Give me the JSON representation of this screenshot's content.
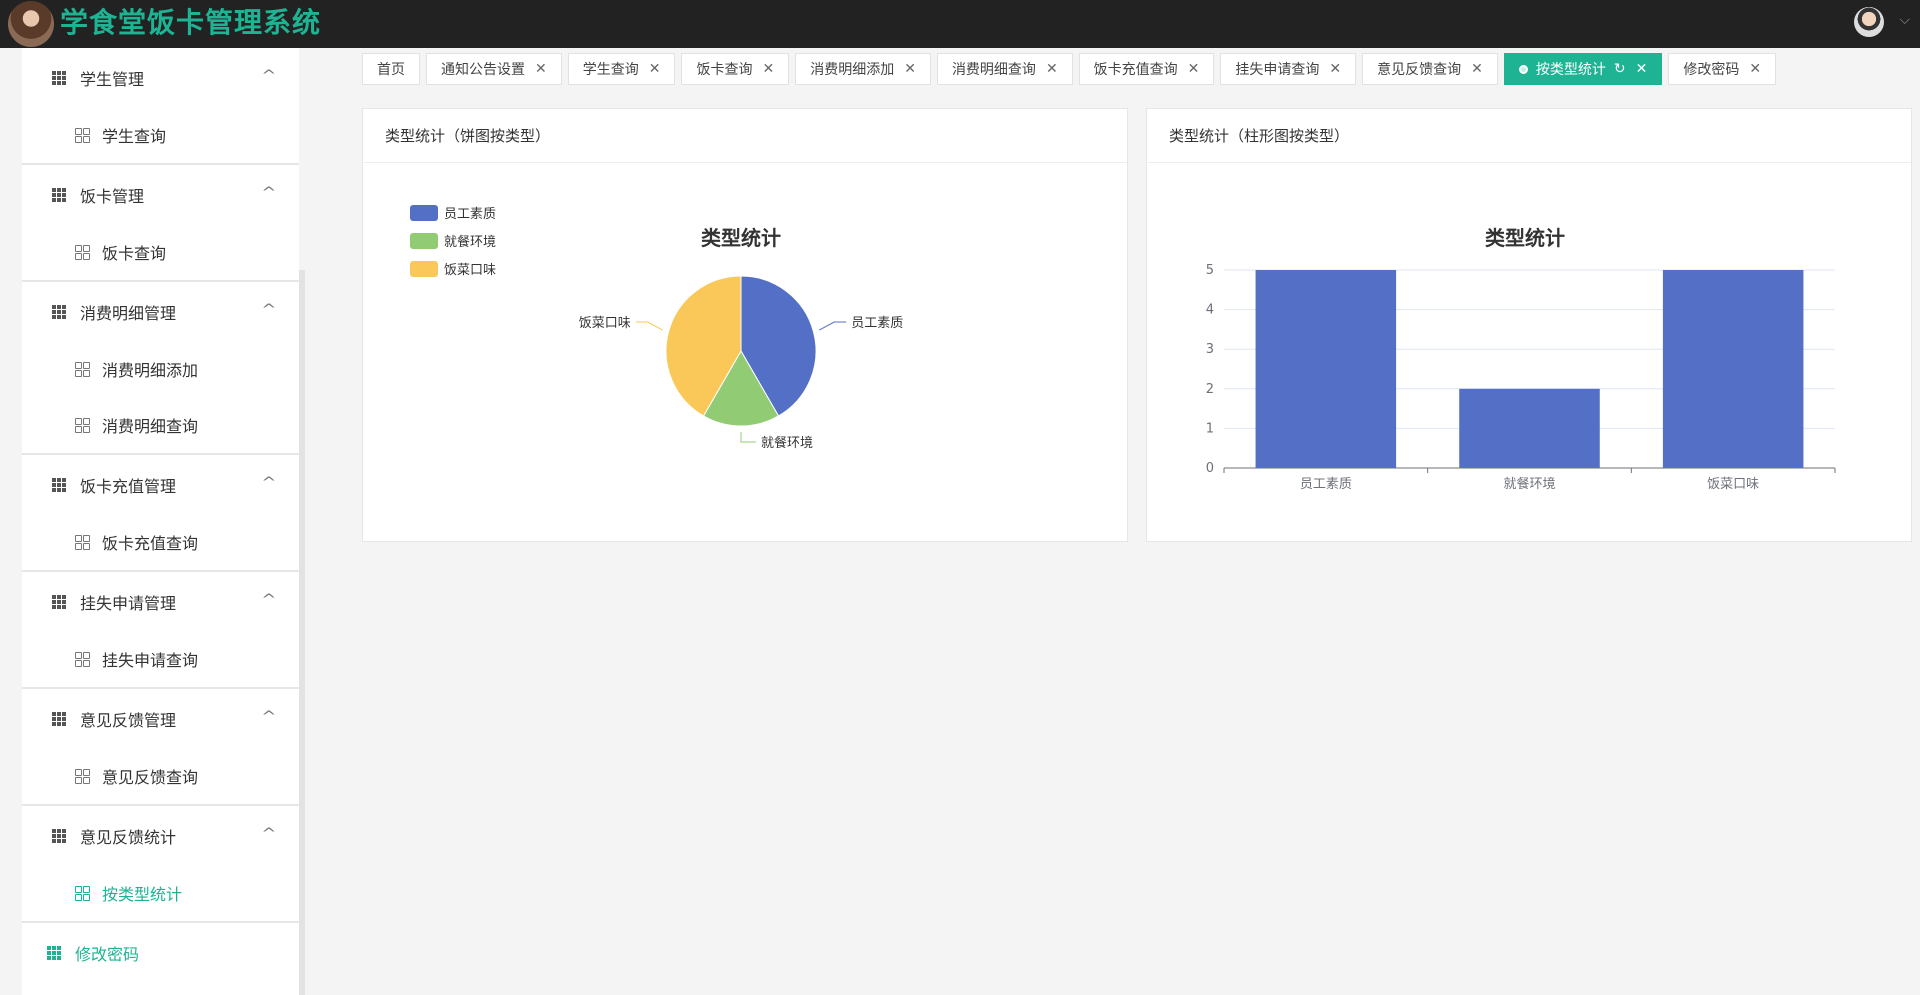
{
  "header": {
    "title": "学食堂饭卡管理系统"
  },
  "sidebar": {
    "groups": [
      {
        "label": "学生管理",
        "items": [
          "学生查询"
        ]
      },
      {
        "label": "饭卡管理",
        "items": [
          "饭卡查询"
        ]
      },
      {
        "label": "消费明细管理",
        "items": [
          "消费明细添加",
          "消费明细查询"
        ]
      },
      {
        "label": "饭卡充值管理",
        "items": [
          "饭卡充值查询"
        ]
      },
      {
        "label": "挂失申请管理",
        "items": [
          "挂失申请查询"
        ]
      },
      {
        "label": "意见反馈管理",
        "items": [
          "意见反馈查询"
        ]
      },
      {
        "label": "意见反馈统计",
        "items": [
          "按类型统计"
        ]
      }
    ],
    "bottom_item": "修改密码",
    "active_item": "按类型统计"
  },
  "tabs": [
    {
      "label": "首页",
      "closable": false
    },
    {
      "label": "通知公告设置",
      "closable": true
    },
    {
      "label": "学生查询",
      "closable": true
    },
    {
      "label": "饭卡查询",
      "closable": true
    },
    {
      "label": "消费明细添加",
      "closable": true
    },
    {
      "label": "消费明细查询",
      "closable": true
    },
    {
      "label": "饭卡充值查询",
      "closable": true
    },
    {
      "label": "挂失申请查询",
      "closable": true
    },
    {
      "label": "意见反馈查询",
      "closable": true
    },
    {
      "label": "按类型统计",
      "closable": true,
      "active": true
    },
    {
      "label": "修改密码",
      "closable": true
    }
  ],
  "cards": {
    "pie_title": "类型统计（饼图按类型）",
    "bar_title": "类型统计（柱形图按类型）"
  },
  "colors": {
    "accent": "#1eb393",
    "blue": "#5470c6",
    "green": "#91cc75",
    "yellow": "#fac858"
  },
  "chart_data": [
    {
      "type": "pie",
      "title": "类型统计",
      "categories": [
        "员工素质",
        "就餐环境",
        "饭菜口味"
      ],
      "values": [
        5,
        2,
        5
      ],
      "colors": [
        "#5470c6",
        "#91cc75",
        "#fac858"
      ],
      "legend": [
        "员工素质",
        "就餐环境",
        "饭菜口味"
      ],
      "legend_position": "top-left"
    },
    {
      "type": "bar",
      "title": "类型统计",
      "categories": [
        "员工素质",
        "就餐环境",
        "饭菜口味"
      ],
      "values": [
        5,
        2,
        5
      ],
      "ylim": [
        0,
        5
      ],
      "yticks": [
        0,
        1,
        2,
        3,
        4,
        5
      ],
      "grid": true,
      "color": "#5470c6"
    }
  ]
}
